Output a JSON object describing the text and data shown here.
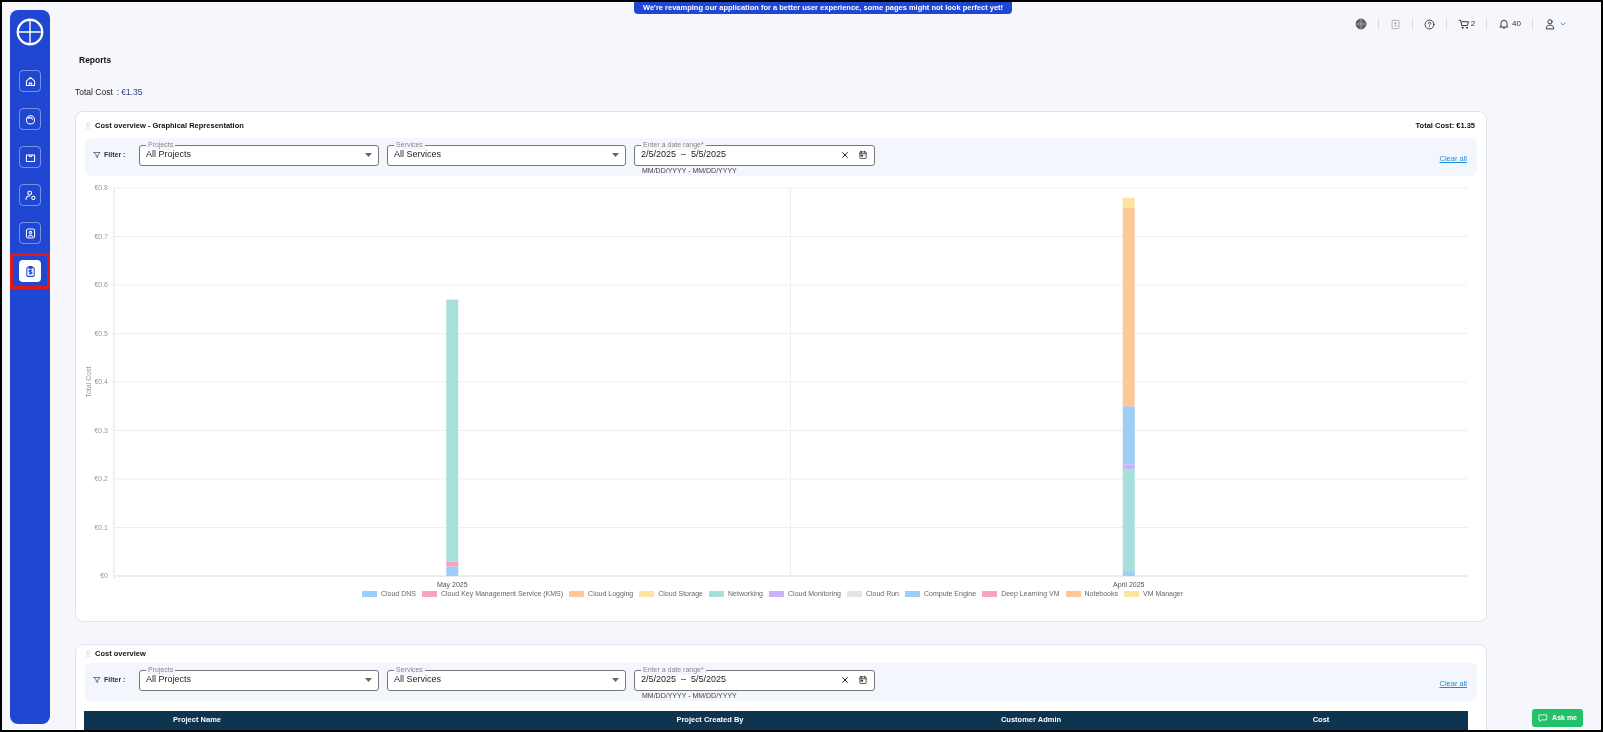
{
  "banner": "We're revamping our application for a better user experience, some pages might not look perfect yet!",
  "sidebar": {
    "items": [
      {
        "selected": false,
        "highlighted": false
      },
      {
        "selected": false,
        "highlighted": false
      },
      {
        "selected": false,
        "highlighted": false
      },
      {
        "selected": false,
        "highlighted": false
      },
      {
        "selected": false,
        "highlighted": false
      },
      {
        "selected": true,
        "highlighted": true
      }
    ]
  },
  "header": {
    "cart_count": "2",
    "notification_count": "40"
  },
  "page_title": "Reports",
  "total_cost": {
    "label": "Total Cost",
    "separator": ":",
    "value": "€1.35"
  },
  "cards": [
    {
      "title": "Cost overview - Graphical Representation",
      "total_cost": "Total Cost: €1.35",
      "filter": {
        "label": "Filter :",
        "projects": {
          "label": "Projects",
          "value": "All Projects"
        },
        "services": {
          "label": "Services",
          "value": "All Services"
        },
        "date_range": {
          "label": "Enter a date range*",
          "start": "2/5/2025",
          "separator": "–",
          "end": "5/5/2025",
          "hint": "MM/DD/YYYY - MM/DD/YYYY"
        },
        "clear": "Clear all"
      },
      "chart_data": {
        "type": "bar",
        "stacked": true,
        "grid": true,
        "legend": true,
        "ylabel": "Total Cost",
        "categories": [
          "May 2025",
          "April 2025"
        ],
        "ylim": [
          0,
          0.8
        ],
        "yticks": [
          {
            "value": 0,
            "label": "€0"
          },
          {
            "value": 0.1,
            "label": "€0.1"
          },
          {
            "value": 0.2,
            "label": "€0.2"
          },
          {
            "value": 0.3,
            "label": "€0.3"
          },
          {
            "value": 0.4,
            "label": "€0.4"
          },
          {
            "value": 0.5,
            "label": "€0.5"
          },
          {
            "value": 0.6,
            "label": "€0.6"
          },
          {
            "value": 0.7,
            "label": "€0.7"
          },
          {
            "value": 0.8,
            "label": "€0.8"
          }
        ],
        "series": [
          {
            "name": "Cloud DNS",
            "color": "#9fcdf5",
            "values": [
              0.02,
              0.01
            ]
          },
          {
            "name": "Cloud Key Management Service (KMS)",
            "color": "#f7a6b9",
            "values": [
              0.01,
              0
            ]
          },
          {
            "name": "Cloud Logging",
            "color": "#fdc898",
            "values": [
              0,
              0
            ]
          },
          {
            "name": "Cloud Storage",
            "color": "#fde3a2",
            "values": [
              0,
              0
            ]
          },
          {
            "name": "Networking",
            "color": "#a6dfdc",
            "values": [
              0.54,
              0.21
            ]
          },
          {
            "name": "Cloud Monitoring",
            "color": "#c9b3f8",
            "values": [
              0,
              0.01
            ]
          },
          {
            "name": "Cloud Run",
            "color": "#e3e3e5",
            "values": [
              0,
              0
            ]
          },
          {
            "name": "Compute Engine",
            "color": "#9fcdf5",
            "values": [
              0,
              0.12
            ]
          },
          {
            "name": "Deep Learning VM",
            "color": "#f7a6b9",
            "values": [
              0,
              0
            ]
          },
          {
            "name": "Notebooks",
            "color": "#fdc898",
            "values": [
              0,
              0.41
            ]
          },
          {
            "name": "VM Manager",
            "color": "#fde3a2",
            "values": [
              0,
              0.02
            ]
          }
        ]
      }
    },
    {
      "title": "Cost overview",
      "filter": {
        "label": "Filter :",
        "projects": {
          "label": "Projects",
          "value": "All Projects"
        },
        "services": {
          "label": "Services",
          "value": "All Services"
        },
        "date_range": {
          "label": "Enter a date range*",
          "start": "2/5/2025",
          "separator": "–",
          "end": "5/5/2025",
          "hint": "MM/DD/YYYY - MM/DD/YYYY"
        },
        "clear": "Clear all"
      },
      "table": {
        "columns": [
          "Project Name",
          "Project Created By",
          "Customer Admin",
          "Cost"
        ]
      }
    }
  ],
  "ask_button": "Ask me"
}
